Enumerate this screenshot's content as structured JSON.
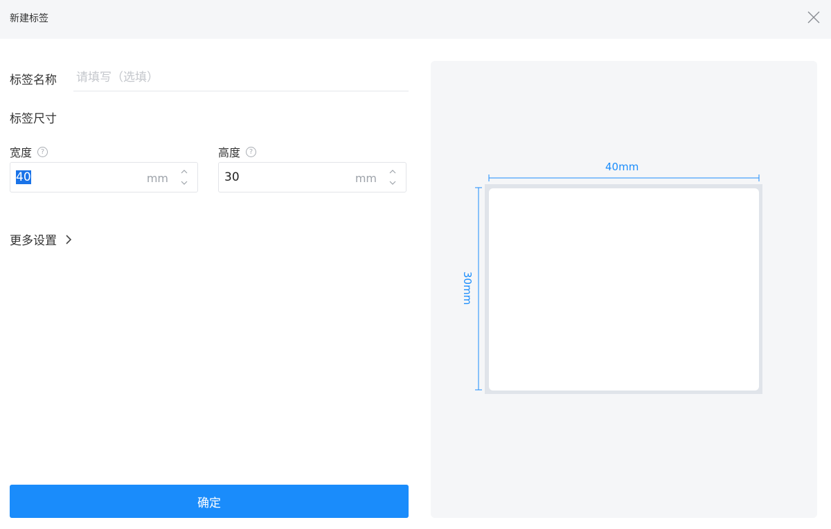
{
  "window": {
    "title": "新建标签"
  },
  "form": {
    "name_label": "标签名称",
    "name_value": "",
    "name_placeholder": "请填写（选填）",
    "size_label": "标签尺寸",
    "width_label": "宽度",
    "width_value": "40",
    "width_unit": "mm",
    "height_label": "高度",
    "height_value": "30",
    "height_unit": "mm",
    "help_glyph": "?",
    "more_settings_label": "更多设置",
    "confirm_label": "确定"
  },
  "preview": {
    "width_dim": "40mm",
    "height_dim": "30mm"
  },
  "colors": {
    "accent": "#1a8cfb",
    "titlebar_bg": "#f5f6f8",
    "preview_bg": "#f5f6f8"
  },
  "icons": {
    "close": "close-icon",
    "help": "question-circle-icon",
    "more": "chevron-right-icon",
    "spin_up": "chevron-up-icon",
    "spin_down": "chevron-down-icon"
  }
}
